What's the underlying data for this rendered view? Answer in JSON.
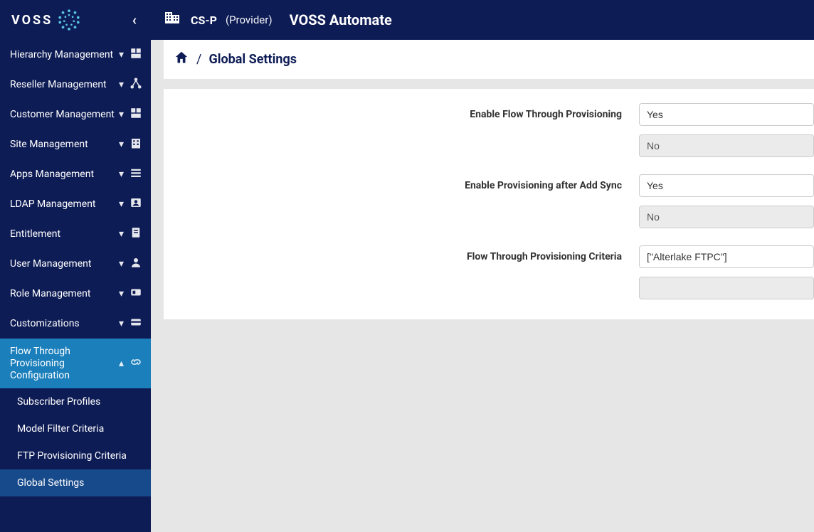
{
  "brand": {
    "name": "VOSS"
  },
  "topbar": {
    "provider_code": "CS-P",
    "provider_label": "(Provider)",
    "app_title": "VOSS Automate"
  },
  "breadcrumb": {
    "title": "Global Settings"
  },
  "sidebar": {
    "items": [
      {
        "label": "Hierarchy Management",
        "icon": "org"
      },
      {
        "label": "Reseller Management",
        "icon": "share"
      },
      {
        "label": "Customer Management",
        "icon": "org"
      },
      {
        "label": "Site Management",
        "icon": "building"
      },
      {
        "label": "Apps Management",
        "icon": "grid"
      },
      {
        "label": "LDAP Management",
        "icon": "contact"
      },
      {
        "label": "Entitlement",
        "icon": "doc"
      },
      {
        "label": "User Management",
        "icon": "person"
      },
      {
        "label": "Role Management",
        "icon": "badge"
      },
      {
        "label": "Customizations",
        "icon": "card"
      },
      {
        "label": "Flow Through Provisioning Configuration",
        "icon": "link",
        "expanded": true
      }
    ],
    "sub_items": [
      {
        "label": "Subscriber Profiles"
      },
      {
        "label": "Model Filter Criteria"
      },
      {
        "label": "FTP Provisioning Criteria"
      },
      {
        "label": "Global Settings",
        "active": true
      }
    ]
  },
  "form": {
    "rows": [
      {
        "label": "Enable Flow Through Provisioning",
        "value": "Yes",
        "secondary": "No"
      },
      {
        "label": "Enable Provisioning after Add Sync",
        "value": "Yes",
        "secondary": "No"
      },
      {
        "label": "Flow Through Provisioning Criteria",
        "value": "[\"Alterlake FTPC\"]",
        "secondary": ""
      }
    ]
  }
}
